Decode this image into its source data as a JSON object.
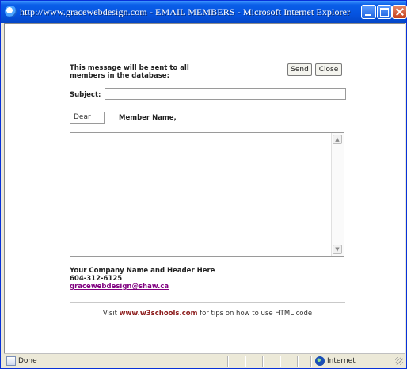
{
  "window": {
    "title": "http://www.gracewebdesign.com - EMAIL MEMBERS - Microsoft Internet Explorer"
  },
  "form": {
    "intro_line1": "This message will be sent to all",
    "intro_line2": "members in the database:",
    "send_label": "Send",
    "close_label": "Close",
    "subject_label": "Subject:",
    "subject_value": "",
    "dear_value": "Dear",
    "member_label": "Member Name,",
    "message_value": ""
  },
  "footer": {
    "company": "Your Company Name and Header Here",
    "phone": "604-312-6125",
    "email": "gracewebdesign@shaw.ca",
    "visit_prefix": "Visit ",
    "visit_link": "www.w3schools.com",
    "visit_suffix": " for tips on how to use HTML code"
  },
  "statusbar": {
    "status": "Done",
    "zone": "Internet"
  },
  "colors": {
    "titlebar": "#0553e0",
    "link_visited": "#800080",
    "visit_link": "#8b1a1a"
  },
  "icons": [
    "ie-icon",
    "minimize-icon",
    "maximize-icon",
    "close-icon",
    "page-icon",
    "internet-zone-icon",
    "resize-grip-icon"
  ]
}
